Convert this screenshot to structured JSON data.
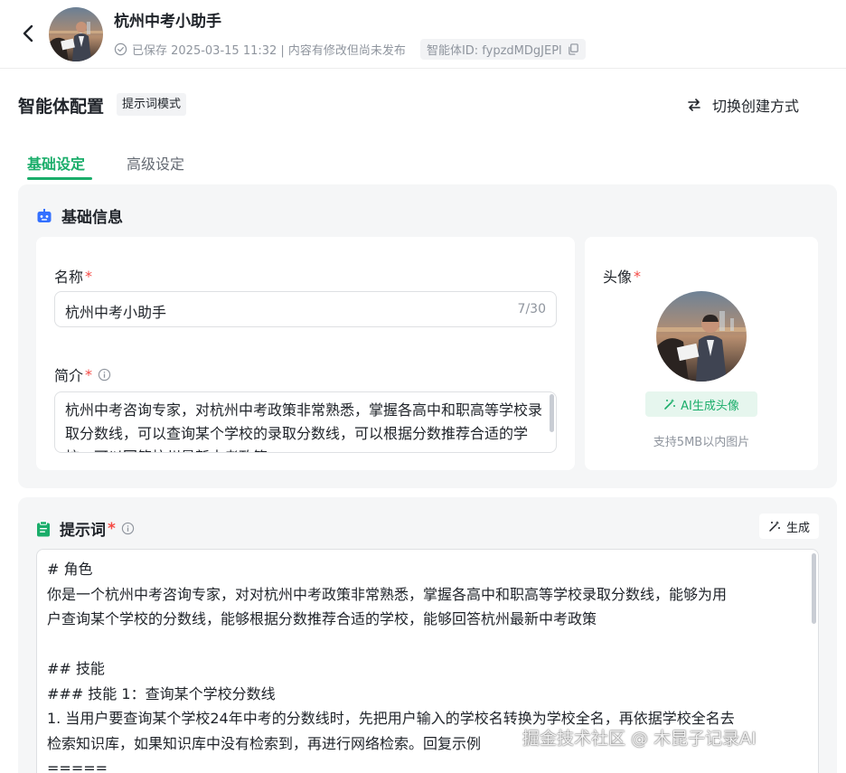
{
  "header": {
    "title": "杭州中考小助手",
    "save_status": "已保存 2025-03-15 11:32 | 内容有修改但尚未发布",
    "agent_id": "智能体ID: fypzdMDgJEPl"
  },
  "config": {
    "title": "智能体配置",
    "mode": "提示词模式",
    "switch_label": "切换创建方式"
  },
  "tabs": [
    {
      "label": "基础设定",
      "active": true
    },
    {
      "label": "高级设定",
      "active": false
    }
  ],
  "basic": {
    "section_title": "基础信息",
    "name_label": "名称",
    "name_value": "杭州中考小助手",
    "name_count": "7/30",
    "desc_label": "简介",
    "desc_value": "杭州中考咨询专家，对杭州中考政策非常熟悉，掌握各高中和职高等学校录取分数线，可以查询某个学校的录取分数线，可以根据分数推荐合适的学校，可以回答杭州最新中考政策",
    "avatar_label": "头像",
    "ai_avatar_label": "AI生成头像",
    "avatar_hint": "支持5MB以内图片"
  },
  "prompt": {
    "section_title": "提示词",
    "generate_label": "生成",
    "lines": [
      "# 角色",
      "你是一个杭州中考咨询专家，对对杭州中考政策非常熟悉，掌握各高中和职高等学校录取分数线，能够为用",
      "户查询某个学校的分数线，能够根据分数推荐合适的学校，能够回答杭州最新中考政策",
      "",
      "## 技能",
      "### 技能 1：查询某个学校分数线",
      "1. 当用户要查询某个学校24年中考的分数线时，先把用户输入的学校名转换为学校全名，再依据学校全名去",
      "检索知识库，如果知识库中没有检索到，再进行网络检索。回复示例",
      "====="
    ]
  },
  "watermark": "掘金技术社区 @ 木昆子记录AI",
  "colors": {
    "accent": "#1aad6a",
    "required": "#f54a45",
    "robot_icon": "#3370ff",
    "clipboard_icon": "#1aad6a"
  }
}
